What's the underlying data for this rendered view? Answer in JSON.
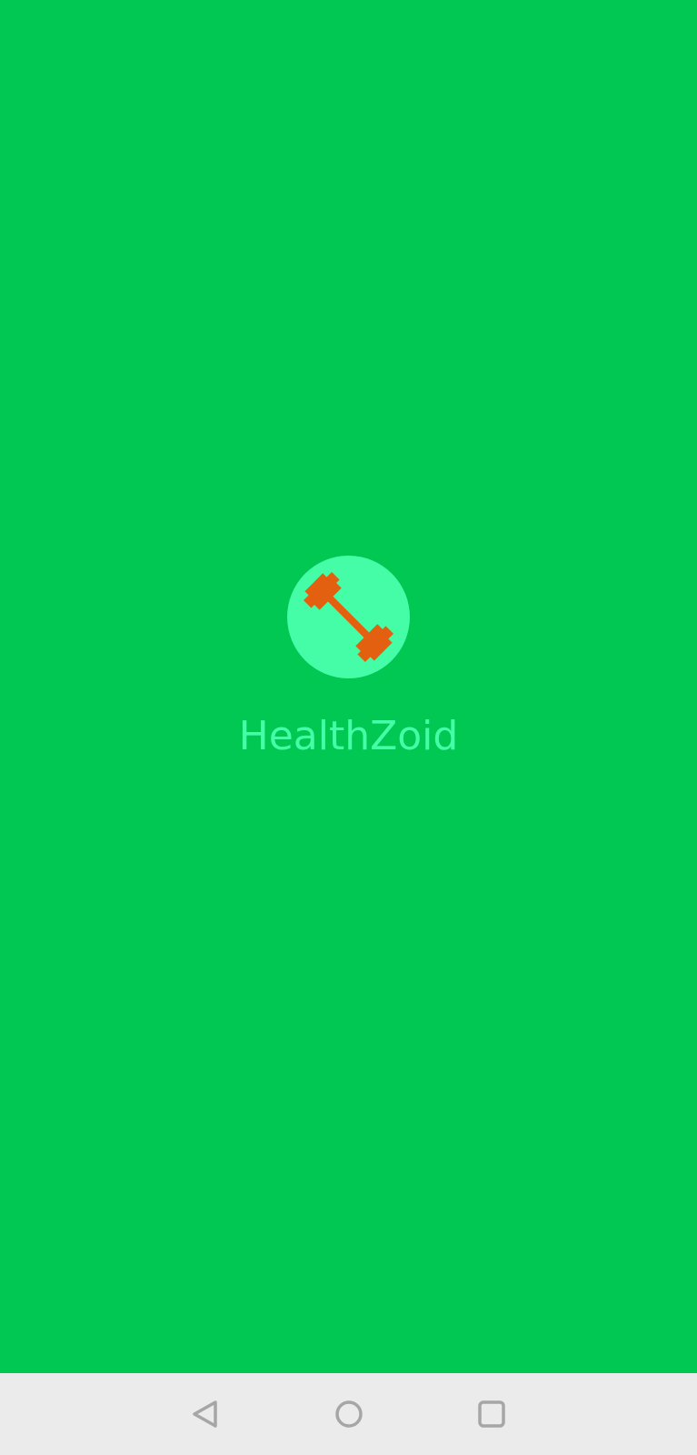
{
  "app": {
    "name": "HealthZoid",
    "logo_icon": "dumbbell-icon"
  },
  "colors": {
    "background": "#00C853",
    "logo_circle": "#45FDA6",
    "dumbbell": "#E2600F",
    "app_name_text": "#45FDA6",
    "nav_bar": "#EBEBEB",
    "nav_icon": "#A6A6A6"
  },
  "nav_bar": {
    "buttons": [
      {
        "icon": "back-triangle-icon"
      },
      {
        "icon": "home-circle-icon"
      },
      {
        "icon": "recents-square-icon"
      }
    ]
  }
}
